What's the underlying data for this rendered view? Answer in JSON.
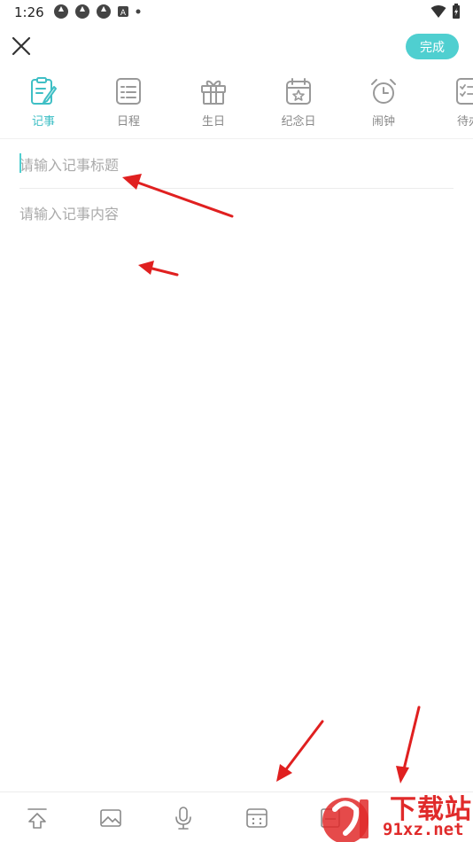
{
  "status_bar": {
    "time": "1:26"
  },
  "header": {
    "done_label": "完成"
  },
  "tabs": [
    {
      "label": "记事",
      "icon": "memo-edit-icon",
      "active": true
    },
    {
      "label": "日程",
      "icon": "schedule-list-icon",
      "active": false
    },
    {
      "label": "生日",
      "icon": "gift-icon",
      "active": false
    },
    {
      "label": "纪念日",
      "icon": "calendar-star-icon",
      "active": false
    },
    {
      "label": "闹钟",
      "icon": "alarm-clock-icon",
      "active": false
    },
    {
      "label": "待办",
      "icon": "todo-checklist-icon",
      "active": false
    }
  ],
  "editor": {
    "title_placeholder": "请输入记事标题",
    "content_placeholder": "请输入记事内容"
  },
  "toolbar": {
    "items": [
      "upload-icon",
      "image-icon",
      "microphone-icon",
      "calendar-grid-icon",
      "save-icon"
    ]
  },
  "watermark": {
    "line1": "下载站",
    "line2": "91xz.net"
  },
  "colors": {
    "accent": "#4fcfd0",
    "annotation": "#e02020"
  }
}
